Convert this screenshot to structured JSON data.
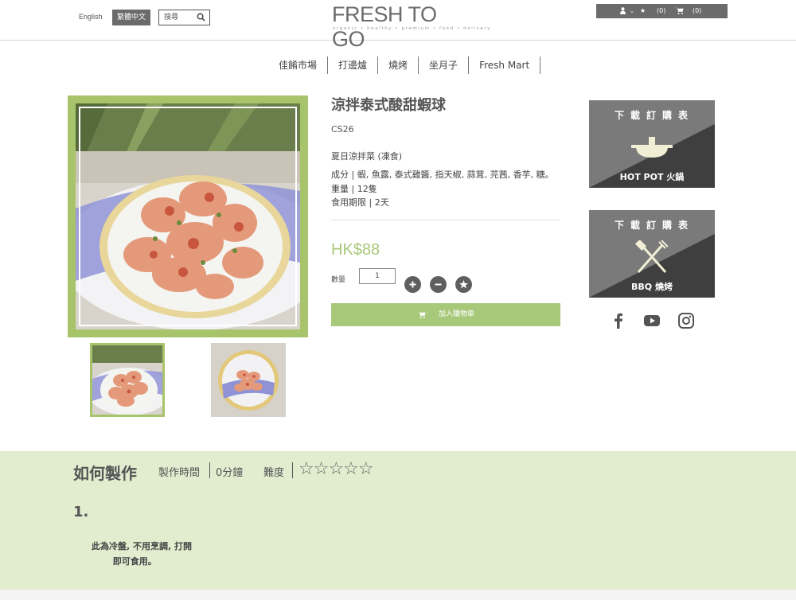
{
  "header": {
    "lang_en": "English",
    "lang_zh": "繁體中文",
    "search_placeholder": "搜尋",
    "logo_text": "FRESH TO GO",
    "logo_tagline": "organic • healthy • premium • food • delivery",
    "wishlist_count": "(0)",
    "cart_count": "(0)"
  },
  "nav": {
    "items": [
      "佳餚市場",
      "打邊爐",
      "燒烤",
      "坐月子",
      "Fresh Mart"
    ]
  },
  "product": {
    "title": "涼拌泰式酸甜蝦球",
    "code": "CS26",
    "category": "夏日涼拌菜 (凍食)",
    "ingredients": "成分 | 蝦, 魚露, 泰式雞醬, 指天椒, 蒜茸, 芫茜, 香芋, 糖。",
    "quantity_info": "重量 | 12隻",
    "shelf_life": "食用期限 | 2天",
    "price": "HK$88",
    "qty_label": "數量",
    "qty_value": "1",
    "add_to_cart": "加入購物車"
  },
  "banners": [
    {
      "title": "下載訂購表",
      "foot": "HOT POT 火鍋",
      "icon": "hotpot-icon"
    },
    {
      "title": "下載訂購表",
      "foot": "BBQ 燒烤",
      "icon": "bbq-icon"
    }
  ],
  "how_to": {
    "title": "如何製作",
    "time_label": "製作時間",
    "time_value": "0分鐘",
    "difficulty_label": "難度",
    "stars": "☆☆☆☆☆",
    "step_number": "1.",
    "step_text": "此為冷盤, 不用烹調, 打開\n       即可食用。"
  },
  "colors": {
    "accent_green": "#a8c87a",
    "frame_green": "#a8c46a",
    "dark_gray": "#5f5f5f",
    "section_bg": "#e2edd0"
  }
}
